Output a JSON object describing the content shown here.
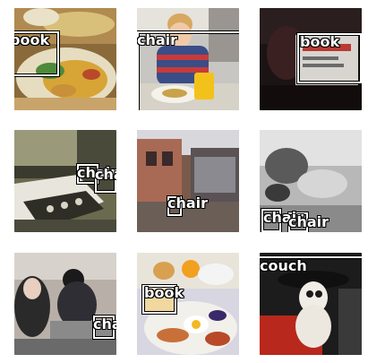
{
  "tiles": [
    {
      "id": 1,
      "labels": [
        "book"
      ]
    },
    {
      "id": 2,
      "labels": [
        "chair"
      ]
    },
    {
      "id": 3,
      "labels": [
        "book"
      ]
    },
    {
      "id": 4,
      "labels": [
        "chair",
        "chair"
      ]
    },
    {
      "id": 5,
      "labels": [
        "chair"
      ]
    },
    {
      "id": 6,
      "labels": [
        "chair",
        "chair"
      ]
    },
    {
      "id": 7,
      "labels": [
        "chair"
      ]
    },
    {
      "id": 8,
      "labels": [
        "book"
      ]
    },
    {
      "id": 9,
      "labels": [
        "couch"
      ]
    }
  ]
}
